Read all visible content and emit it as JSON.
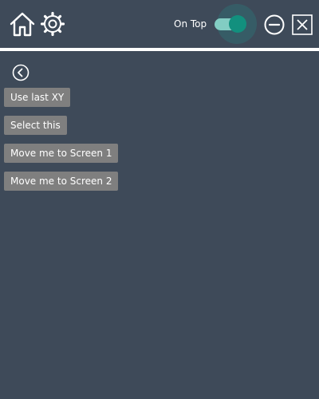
{
  "header": {
    "on_top_label": "On Top",
    "on_top_enabled": true,
    "accent_color": "#12907e"
  },
  "icons": {
    "home": "home-icon",
    "settings": "gear-icon",
    "minimize": "minus-circle-icon",
    "close": "close-icon",
    "back": "chevron-left-circle-icon"
  },
  "actions": [
    {
      "label": "Use last XY"
    },
    {
      "label": "Select this"
    },
    {
      "label": "Move me to Screen 1"
    },
    {
      "label": "Move me to Screen 2"
    }
  ]
}
